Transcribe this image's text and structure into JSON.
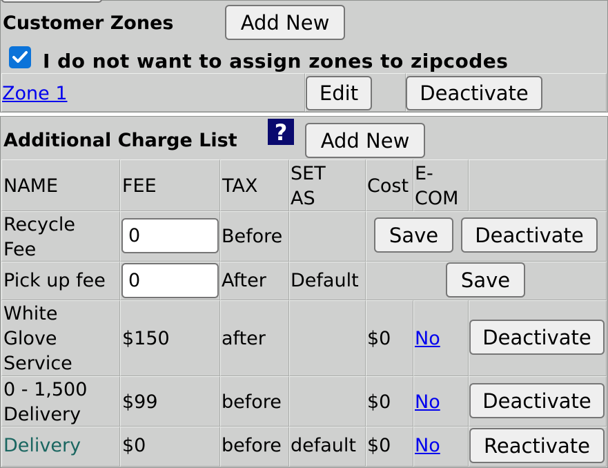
{
  "zones": {
    "title": "Customer Zones",
    "add_new_label": "Add New",
    "checkbox_checked": true,
    "checkbox_label": "I do not want to assign zones to zipcodes",
    "zone_name": "Zone 1",
    "edit_label": "Edit",
    "deactivate_label": "Deactivate"
  },
  "charges": {
    "title": "Additional Charge List",
    "help_icon": "question-mark-icon",
    "add_new_label": "Add New",
    "headers": {
      "name": "NAME",
      "fee": "FEE",
      "tax": "TAX",
      "set_as_1": "SET",
      "set_as_2": "AS",
      "cost": "Cost",
      "ecom_1": "E-",
      "ecom_2": "COM"
    },
    "rows": [
      {
        "name_1": "Recycle",
        "name_2": "Fee",
        "fee_value": "0",
        "tax": "Before",
        "set_as": "",
        "save_label": "Save",
        "action_label": "Deactivate"
      },
      {
        "name": "Pick up fee",
        "fee_value": "0",
        "tax": "After",
        "set_as": "Default",
        "save_label": "Save"
      },
      {
        "name_1": "White",
        "name_2": "Glove",
        "name_3": "Service",
        "fee": "$150",
        "tax": "after",
        "set_as": "",
        "cost": "$0",
        "ecom": "No",
        "action_label": "Deactivate"
      },
      {
        "name_1": "0 - 1,500",
        "name_2": "Delivery",
        "fee": "$99",
        "tax": "before",
        "set_as": "",
        "cost": "$0",
        "ecom": "No",
        "action_label": "Deactivate"
      },
      {
        "name": "Delivery",
        "fee": "$0",
        "tax": "before",
        "set_as": "default",
        "cost": "$0",
        "ecom": "No",
        "action_label": "Reactivate"
      }
    ]
  },
  "colors": {
    "panel": "#cfd0cf",
    "link": "#0000ee",
    "inactive_name": "#1a6660",
    "checkbox_accent": "#0b73d9",
    "help_icon_bg": "#0a0a6e"
  }
}
